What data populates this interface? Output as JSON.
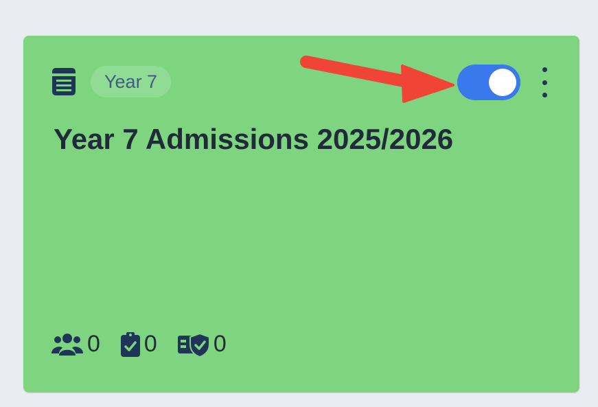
{
  "card": {
    "tag": "Year 7",
    "title": "Year 7 Admissions 2025/2026",
    "enabled": true,
    "background": "#7fd57f",
    "accent": "#3a78ee",
    "stats": [
      {
        "icon": "users-icon",
        "value": "0"
      },
      {
        "icon": "clipboard-check-icon",
        "value": "0"
      },
      {
        "icon": "shield-check-icon",
        "value": "0"
      }
    ]
  },
  "annotation": {
    "arrow_color": "#ef4436"
  }
}
